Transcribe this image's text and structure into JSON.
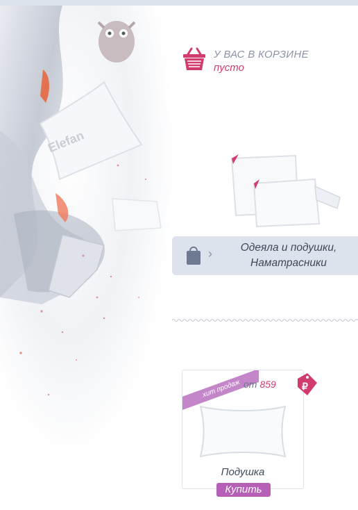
{
  "cart": {
    "title": "У ВАС В КОРЗИНЕ",
    "status": "пусто",
    "icon": "basket-icon"
  },
  "category": {
    "line1": "Одеяла и подушки,",
    "line2": "Наматрасники",
    "icon": "shopping-bag-icon"
  },
  "hero": {
    "brand": "Elefan"
  },
  "product": {
    "badge": "хит продаж",
    "price_prefix": "от",
    "price": "859",
    "currency_icon": "ruble-tag-icon",
    "name": "Подушка",
    "buy_label": "Купить"
  },
  "colors": {
    "accent": "#d23b6e",
    "badge": "#c386c9",
    "button": "#b65fb6",
    "panel": "#dde3ec"
  }
}
